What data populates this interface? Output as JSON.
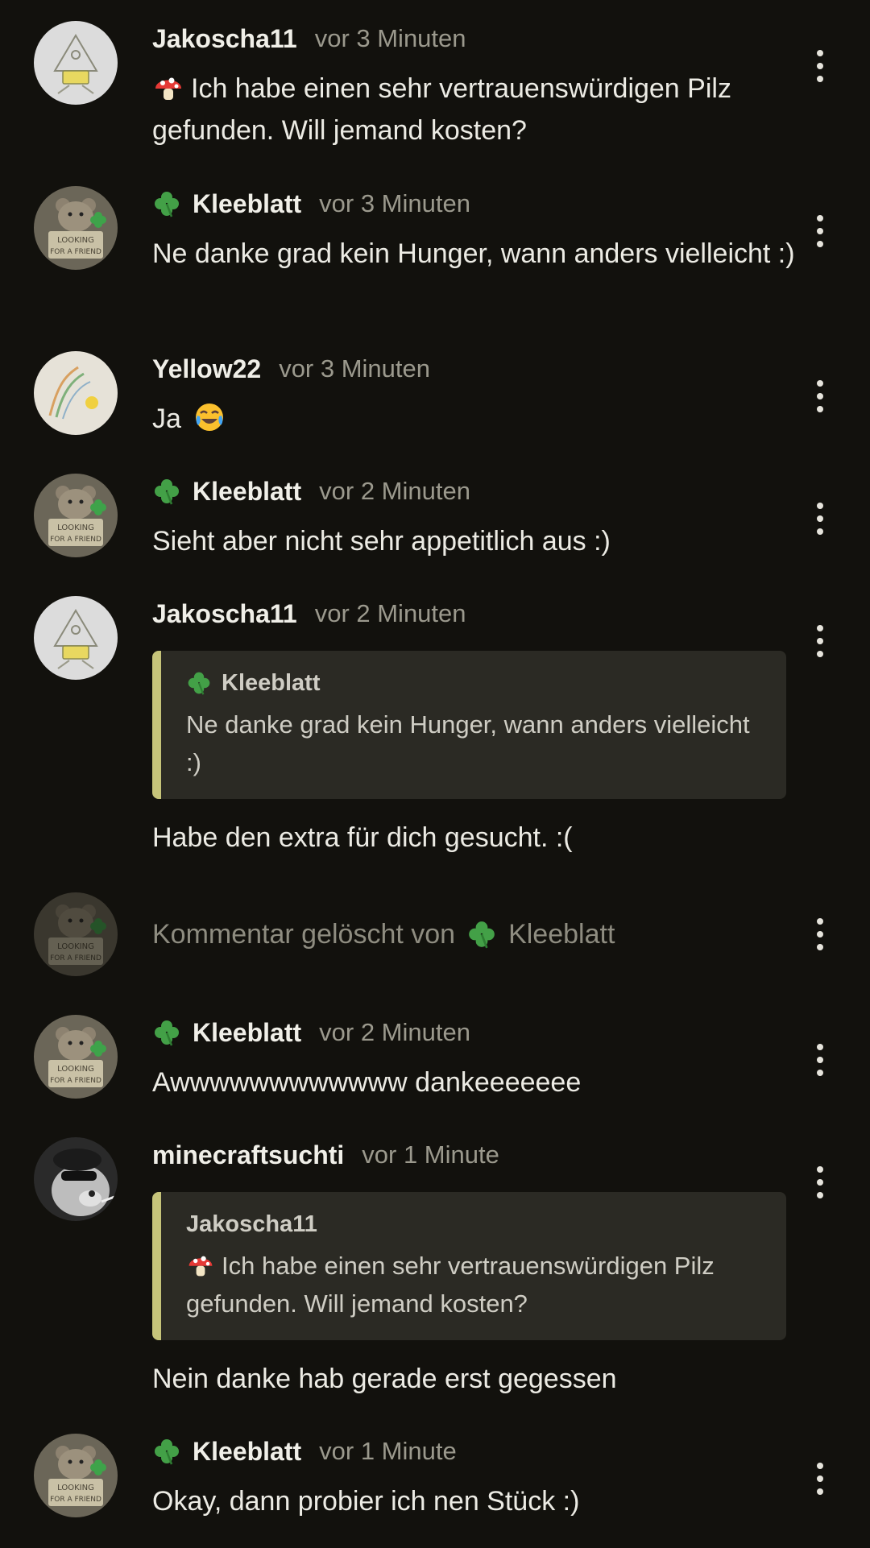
{
  "comments": [
    {
      "username": "Jakoscha11",
      "time": "vor 3 Minuten",
      "text_emoji": "mushroom-emoji",
      "text": "Ich habe einen sehr vertrauenswürdigen Pilz gefunden. Will jemand kosten?",
      "avatar": "drawing-avatar"
    },
    {
      "username": "Kleeblatt",
      "badge": "four-leaf-clover-emoji",
      "time": "vor 3 Minuten",
      "text": "Ne danke grad kein Hunger, wann anders vielleicht :)",
      "avatar": "teddy-bear-avatar"
    },
    {
      "username": "Yellow22",
      "time": "vor 3 Minuten",
      "text": "Ja",
      "trailing_emoji": "tears-of-joy-emoji",
      "avatar": "sketch-avatar"
    },
    {
      "username": "Kleeblatt",
      "badge": "four-leaf-clover-emoji",
      "time": "vor 2 Minuten",
      "text": "Sieht aber nicht sehr appetitlich aus :)",
      "avatar": "teddy-bear-avatar"
    },
    {
      "username": "Jakoscha11",
      "time": "vor 2 Minuten",
      "quote": {
        "username": "Kleeblatt",
        "badge": "four-leaf-clover-emoji",
        "text": "Ne danke grad kein Hunger, wann anders vielleicht :)"
      },
      "text": "Habe den extra für dich gesucht. :(",
      "avatar": "drawing-avatar"
    },
    {
      "deleted_prefix": "Kommentar gelöscht von",
      "deleted_user": "Kleeblatt",
      "badge": "four-leaf-clover-emoji",
      "avatar": "teddy-bear-avatar"
    },
    {
      "username": "Kleeblatt",
      "badge": "four-leaf-clover-emoji",
      "time": "vor 2 Minuten",
      "text": "Awwwwwwwwwwww dankeeeeeee",
      "avatar": "teddy-bear-avatar"
    },
    {
      "username": "minecraftsuchti",
      "time": "vor 1 Minute",
      "quote": {
        "username": "Jakoscha11",
        "text_emoji": "mushroom-emoji",
        "text": "Ich habe einen sehr vertrauenswürdigen Pilz gefunden. Will jemand kosten?"
      },
      "text": "Nein danke hab gerade erst gegessen",
      "avatar": "dog-photo-avatar"
    },
    {
      "username": "Kleeblatt",
      "badge": "four-leaf-clover-emoji",
      "time": "vor 1 Minute",
      "text": "Okay, dann probier ich nen Stück :)",
      "avatar": "teddy-bear-avatar"
    }
  ],
  "colors": {
    "background": "#12110d",
    "quote_background": "#2b2a24",
    "quote_accent": "#c6c47a",
    "text": "#ecebe4",
    "muted": "#9b998d",
    "clover": "#43a047"
  }
}
